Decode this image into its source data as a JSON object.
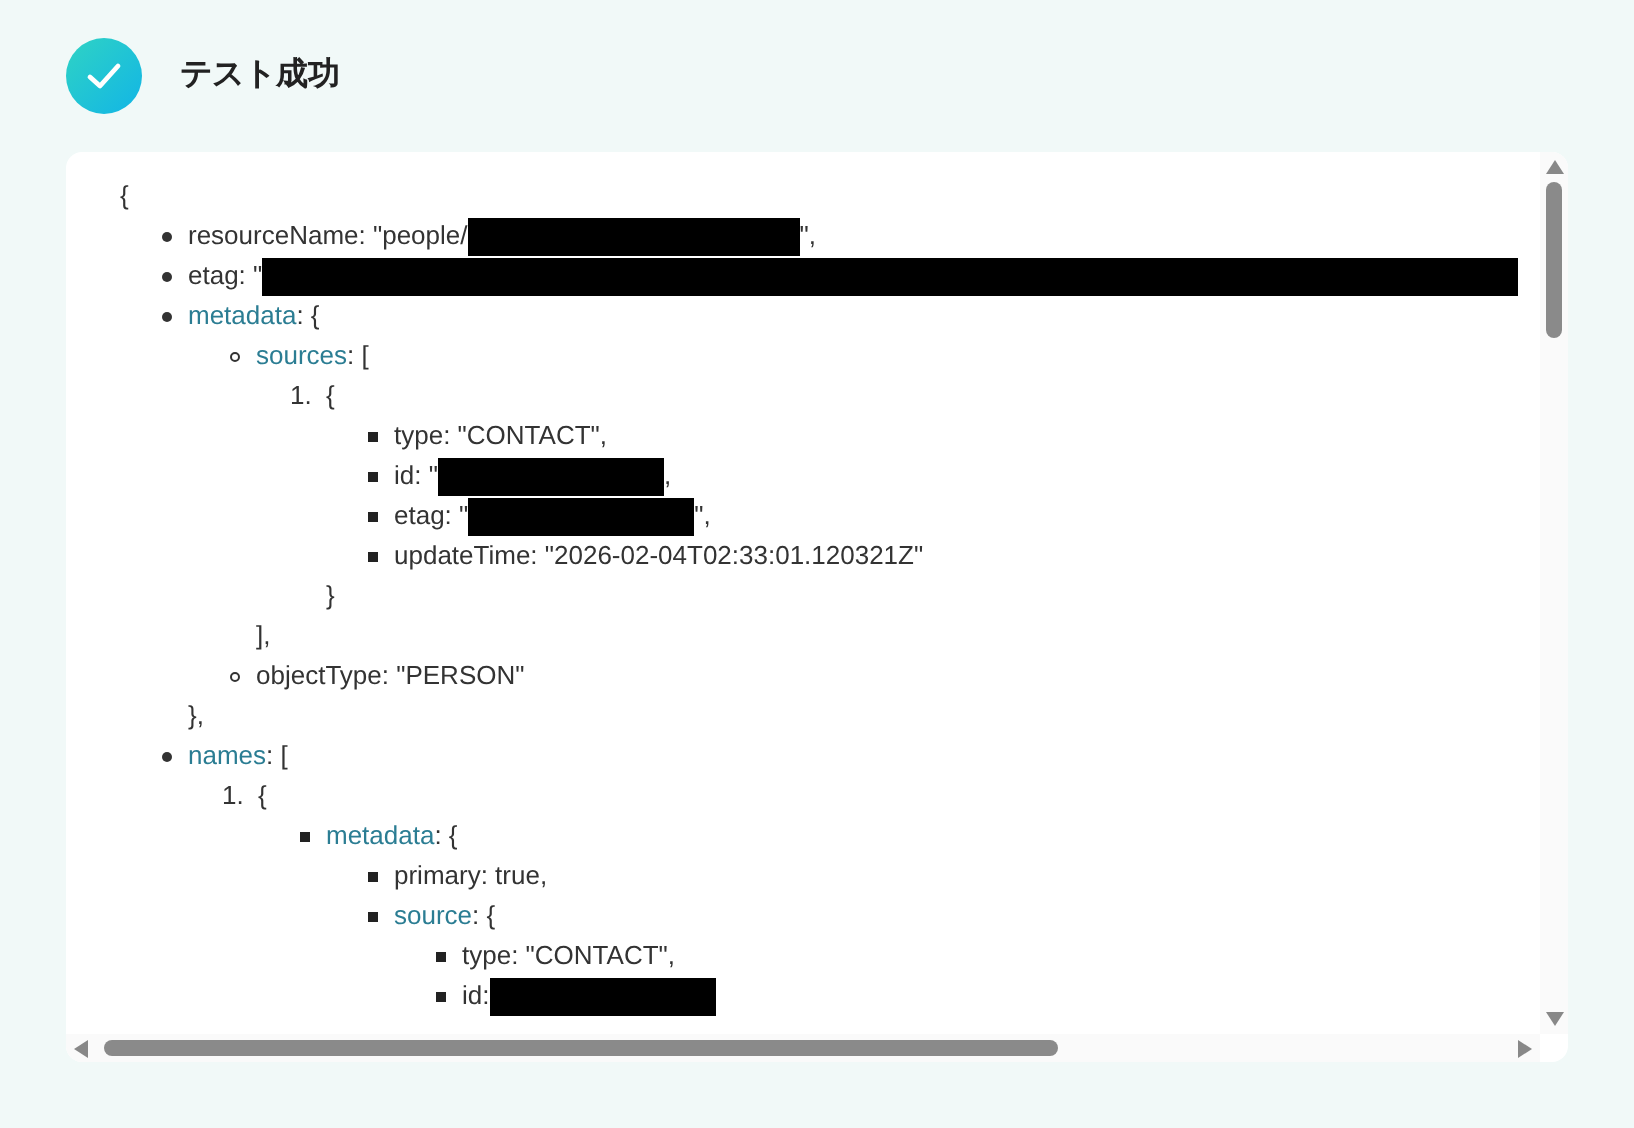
{
  "header": {
    "title": "テスト成功"
  },
  "viewer": {
    "open": "{",
    "list": {
      "kind": "bulleted",
      "items": [
        {
          "parts": [
            {
              "kind": "text",
              "text": "resourceName: \"people/"
            },
            {
              "kind": "redacted_medium"
            },
            {
              "kind": "text",
              "text": "\","
            }
          ]
        },
        {
          "parts": [
            {
              "kind": "text",
              "text": "etag: \""
            },
            {
              "kind": "redacted_full"
            }
          ]
        },
        {
          "parts": [
            {
              "kind": "key",
              "text": "metadata"
            },
            {
              "kind": "text",
              "text": ": {"
            }
          ],
          "close": "},",
          "list": {
            "kind": "bulleted",
            "items": [
              {
                "parts": [
                  {
                    "kind": "key",
                    "text": "sources"
                  },
                  {
                    "kind": "text",
                    "text": ": ["
                  }
                ],
                "close": "],",
                "list": {
                  "kind": "numbered",
                  "items": [
                    {
                      "marker": "1.",
                      "parts": [
                        {
                          "kind": "text",
                          "text": "{"
                        }
                      ],
                      "close": "}",
                      "list": {
                        "kind": "bulleted",
                        "items": [
                          {
                            "parts": [
                              {
                                "kind": "text",
                                "text": "type: \"CONTACT\","
                              }
                            ]
                          },
                          {
                            "parts": [
                              {
                                "kind": "text",
                                "text": "id: \""
                              },
                              {
                                "kind": "redacted_short"
                              },
                              {
                                "kind": "text",
                                "text": ","
                              }
                            ]
                          },
                          {
                            "parts": [
                              {
                                "kind": "text",
                                "text": "etag: \""
                              },
                              {
                                "kind": "redacted_short"
                              },
                              {
                                "kind": "text",
                                "text": "\","
                              }
                            ]
                          },
                          {
                            "parts": [
                              {
                                "kind": "text",
                                "text": "updateTime: \"2026-02-04T02:33:01.120321Z\""
                              }
                            ]
                          }
                        ]
                      }
                    }
                  ]
                }
              },
              {
                "parts": [
                  {
                    "kind": "text",
                    "text": "objectType: \"PERSON\""
                  }
                ]
              }
            ]
          }
        },
        {
          "parts": [
            {
              "kind": "key",
              "text": "names"
            },
            {
              "kind": "text",
              "text": ": ["
            }
          ],
          "list": {
            "kind": "numbered",
            "items": [
              {
                "marker": "1.",
                "parts": [
                  {
                    "kind": "text",
                    "text": "{"
                  }
                ],
                "list": {
                  "kind": "bulleted",
                  "items": [
                    {
                      "parts": [
                        {
                          "kind": "key",
                          "text": "metadata"
                        },
                        {
                          "kind": "text",
                          "text": ": {"
                        }
                      ],
                      "list": {
                        "kind": "bulleted",
                        "items": [
                          {
                            "parts": [
                              {
                                "kind": "text",
                                "text": "primary: true,"
                              }
                            ]
                          },
                          {
                            "parts": [
                              {
                                "kind": "key",
                                "text": "source"
                              },
                              {
                                "kind": "text",
                                "text": ": {"
                              }
                            ],
                            "list": {
                              "kind": "bulleted",
                              "items": [
                                {
                                  "parts": [
                                    {
                                      "kind": "text",
                                      "text": "type: \"CONTACT\","
                                    }
                                  ]
                                },
                                {
                                  "parts": [
                                    {
                                      "kind": "text",
                                      "text": "id: "
                                    },
                                    {
                                      "kind": "redacted_short"
                                    }
                                  ]
                                }
                              ]
                            }
                          }
                        ]
                      }
                    }
                  ]
                }
              }
            ]
          }
        }
      ]
    }
  }
}
